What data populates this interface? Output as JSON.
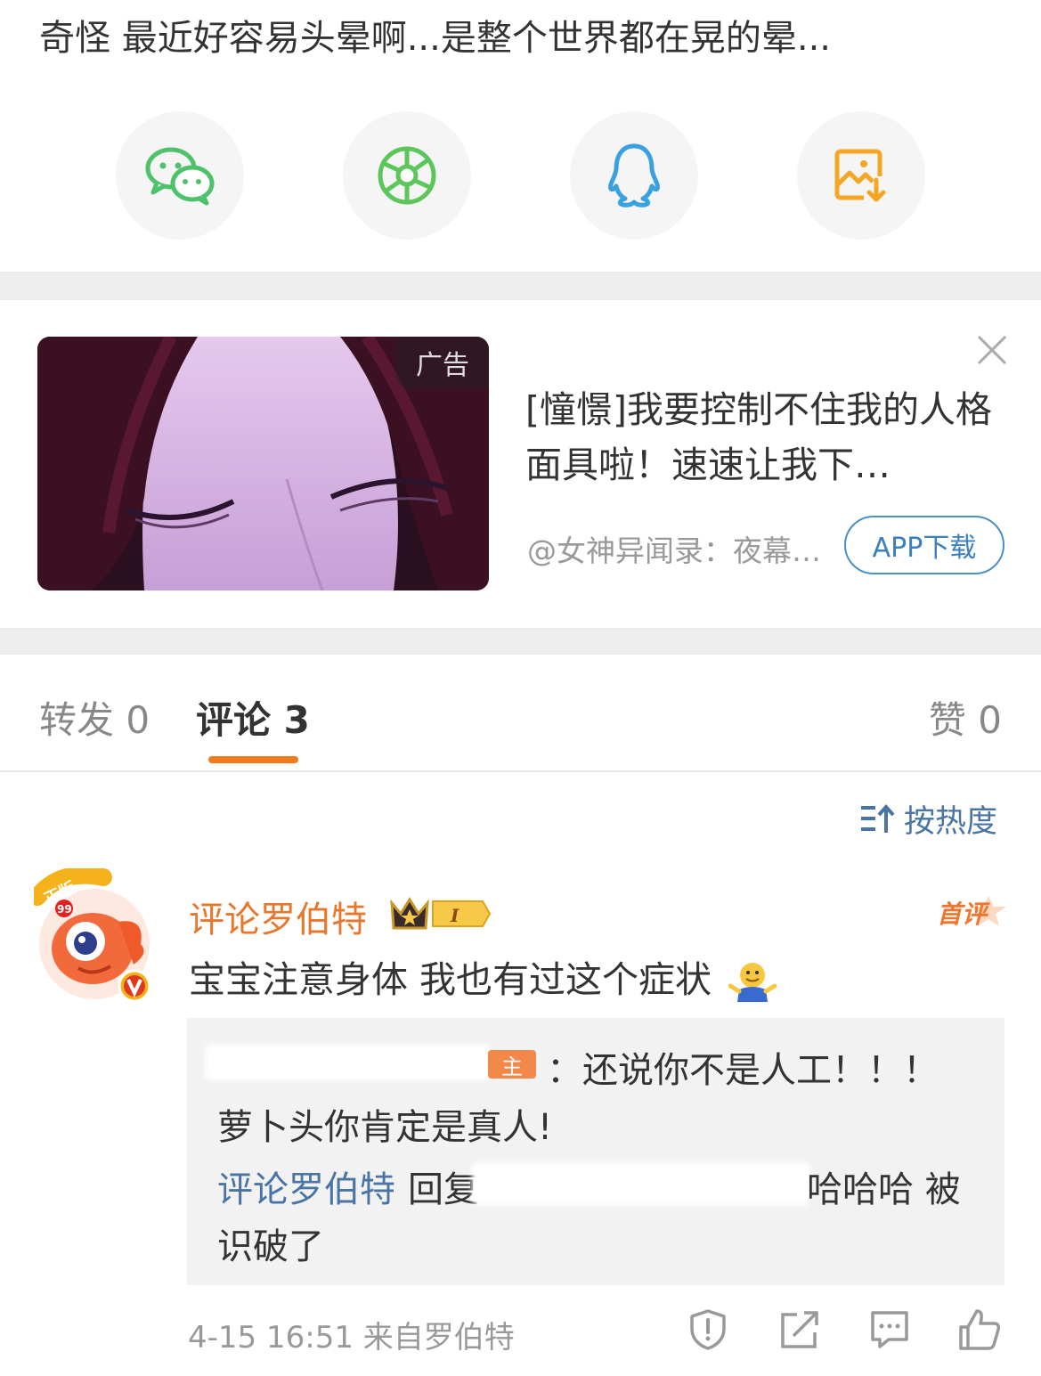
{
  "post": {
    "title": "奇怪 最近好容易头晕啊...是整个世界都在晃的晕..."
  },
  "share": {
    "items": [
      {
        "icon": "wechat-icon",
        "color": "#4ec26a"
      },
      {
        "icon": "moments-icon",
        "color": "#5cc65a"
      },
      {
        "icon": "qq-icon",
        "color": "#3aa1e0"
      },
      {
        "icon": "save-image-icon",
        "color": "#f5a623"
      }
    ]
  },
  "ad": {
    "tag": "广告",
    "text": "[憧憬]我要控制不住我的人格面具啦！速速让我下…",
    "source": "@女神异闻录：夜幕…",
    "button": "APP下载"
  },
  "tabs": {
    "repost": "转发 0",
    "comments": "评论 3",
    "likes": "赞 0"
  },
  "sort": {
    "label": "按热度"
  },
  "comment": {
    "username": "评论罗伯特",
    "badge_level": "I",
    "first_tag": "首评",
    "avatar_label": "正版",
    "avatar_level": "99",
    "text": "宝宝注意身体 我也有过这个症状",
    "reply": {
      "host_tag": "主",
      "line1": "：还说你不是人工！！！",
      "line2": "萝卜头你肯定是真人!",
      "line3_name": "评论罗伯特",
      "line3_verb": "回复",
      "line3_tail": "哈哈哈 被",
      "line4": "识破了"
    },
    "meta": "4-15 16:51 来自罗伯特"
  },
  "colors": {
    "accent_orange": "#f07b1f",
    "link_blue": "#4a74a4",
    "username_orange": "#e8772e"
  }
}
